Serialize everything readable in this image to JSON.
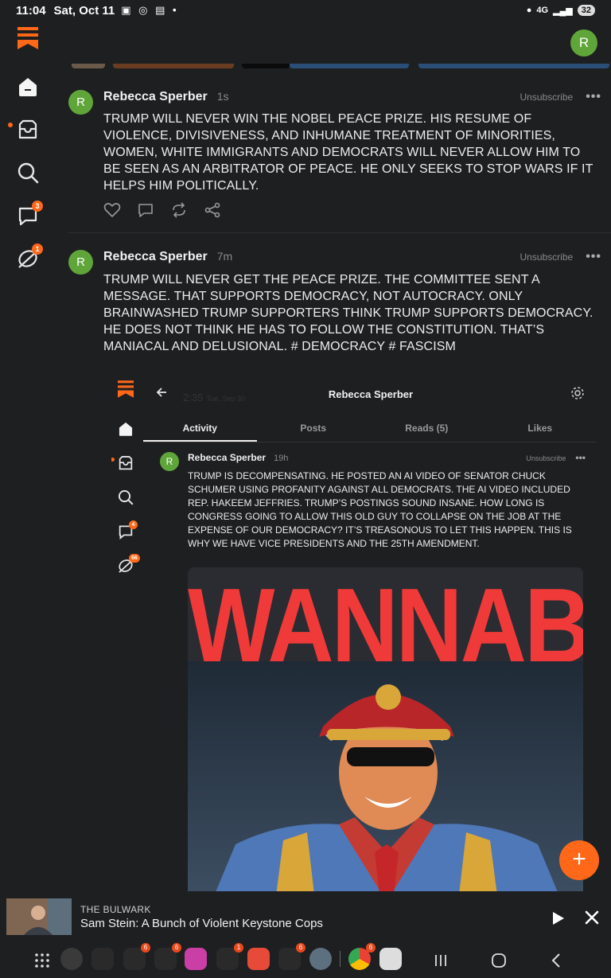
{
  "status_bar": {
    "time": "11:04",
    "date": "Sat, Oct 11",
    "network": "4G",
    "battery": "32"
  },
  "account": {
    "avatar_letter": "R"
  },
  "sidebar": {
    "items": [
      {
        "name": "home",
        "badge": ""
      },
      {
        "name": "inbox",
        "badge": ""
      },
      {
        "name": "search",
        "badge": ""
      },
      {
        "name": "chat",
        "badge": "3"
      },
      {
        "name": "activity",
        "badge": "1"
      }
    ]
  },
  "posts": [
    {
      "avatar_letter": "R",
      "author": "Rebecca Sperber",
      "time": "1s",
      "unsubscribe_label": "Unsubscribe",
      "more_label": "•••",
      "text": "TRUMP WILL NEVER WIN THE NOBEL PEACE PRIZE. HIS RESUME OF VIOLENCE, DIVISIVENESS, AND INHUMANE TREATMENT OF MINORITIES, WOMEN, WHITE IMMIGRANTS AND DEMOCRATS WILL NEVER ALLOW HIM TO BE SEEN AS AN ARBITRATOR OF PEACE. HE ONLY SEEKS TO STOP WARS IF IT HELPS HIM POLITICALLY."
    },
    {
      "avatar_letter": "R",
      "author": "Rebecca Sperber",
      "time": "7m",
      "unsubscribe_label": "Unsubscribe",
      "more_label": "•••",
      "text": "TRUMP WILL NEVER GET THE PEACE PRIZE. THE COMMITTEE SENT A MESSAGE. THAT SUPPORTS DEMOCRACY, NOT AUTOCRACY. ONLY BRAINWASHED TRUMP SUPPORTERS THINK TRUMP SUPPORTS DEMOCRACY. HE DOES NOT THINK HE HAS TO FOLLOW THE CONSTITUTION. THAT’S MANIACAL AND DELUSIONAL. # DEMOCRACY # FASCISM"
    }
  ],
  "embedded": {
    "faded_time": "2:35",
    "faded_date": "Tue, Sep 30",
    "profile_title": "Rebecca Sperber",
    "tabs": [
      {
        "label": "Activity",
        "active": true
      },
      {
        "label": "Posts",
        "active": false
      },
      {
        "label": "Reads (5)",
        "active": false
      },
      {
        "label": "Likes",
        "active": false
      }
    ],
    "rail_badges": {
      "chat": "4",
      "activity": "66"
    },
    "post": {
      "avatar_letter": "R",
      "author": "Rebecca Sperber",
      "time": "19h",
      "unsubscribe_label": "Unsubscribe",
      "more_label": "•••",
      "text": "TRUMP IS DECOMPENSATING. HE POSTED AN AI VIDEO OF SENATOR CHUCK SCHUMER USING PROFANITY AGAINST ALL DEMOCRATS. THE AI VIDEO INCLUDED REP. HAKEEM JEFFRIES. TRUMP’S POSTINGS SOUND INSANE. HOW LONG IS CONGRESS GOING TO ALLOW THIS OLD GUY TO COLLAPSE ON THE JOB AT THE EXPENSE OF OUR DEMOCRACY? IT’S TREASONOUS TO LET THIS HAPPEN. THIS IS WHY WE HAVE VICE PRESIDENTS AND THE 25TH AMENDMENT.",
      "image_text": "WANNABE"
    }
  },
  "fab": {
    "label": "+"
  },
  "player": {
    "source": "THE BULWARK",
    "title": "Sam Stein: A Bunch of Violent Keystone Cops"
  },
  "navbar": {
    "badges": {
      "app2": "6",
      "app3": "6",
      "app5": "1",
      "app7": "6",
      "chrome": "6"
    }
  },
  "colors": {
    "accent": "#ff6719",
    "background": "#1e1f21",
    "avatar": "#5fa53a",
    "banner_red": "#ef3a39"
  }
}
